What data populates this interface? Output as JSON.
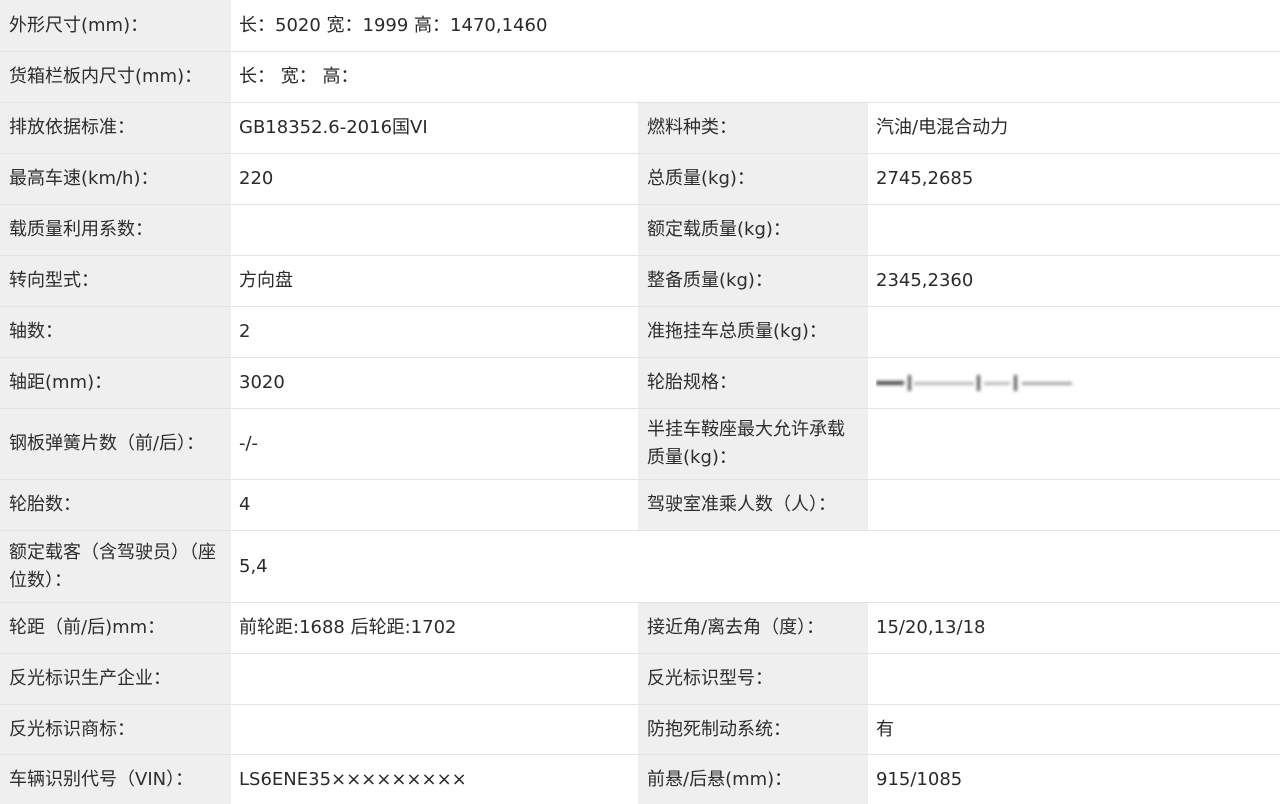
{
  "rows": [
    {
      "label": "外形尺寸(mm)：",
      "value": "长：5020 宽：1999 高：1470,1460"
    },
    {
      "label": "货箱栏板内尺寸(mm)：",
      "value": "长： 宽： 高："
    },
    {
      "label": "排放依据标准：",
      "value": "GB18352.6-2016国VI",
      "label2": "燃料种类：",
      "value2": "汽油/电混合动力"
    },
    {
      "label": "最高车速(km/h)：",
      "value": "220",
      "label2": "总质量(kg)：",
      "value2": "2745,2685"
    },
    {
      "label": "载质量利用系数：",
      "value": "",
      "label2": "额定载质量(kg)：",
      "value2": ""
    },
    {
      "label": "转向型式：",
      "value": "方向盘",
      "label2": "整备质量(kg)：",
      "value2": "2345,2360"
    },
    {
      "label": "轴数：",
      "value": "2",
      "label2": "准拖挂车总质量(kg)：",
      "value2": ""
    },
    {
      "label": "轴距(mm)：",
      "value": "3020",
      "label2": "轮胎规格：",
      "value2": ""
    },
    {
      "label": "钢板弹簧片数（前/后）：",
      "value": "-/-",
      "label2": "半挂车鞍座最大允许承载质量(kg)：",
      "value2": ""
    },
    {
      "label": "轮胎数：",
      "value": "4",
      "label2": "驾驶室准乘人数（人）：",
      "value2": ""
    },
    {
      "label": "额定载客（含驾驶员）（座位数）：",
      "value": "5,4"
    },
    {
      "label": "轮距（前/后)mm：",
      "value": "前轮距:1688 后轮距:1702",
      "label2": "接近角/离去角（度）：",
      "value2": "15/20,13/18"
    },
    {
      "label": "反光标识生产企业：",
      "value": "",
      "label2": "反光标识型号：",
      "value2": ""
    },
    {
      "label": "反光标识商标：",
      "value": "",
      "label2": "防抱死制动系统：",
      "value2": "有"
    },
    {
      "label": "车辆识别代号（VIN）：",
      "value": "LS6ENE35×××××××××",
      "label2": "前悬/后悬(mm)：",
      "value2": "915/1085"
    }
  ],
  "icons": {
    "tire_spec_value": "blurred-redaction-icon"
  },
  "colors": {
    "label_bg": "#efefef",
    "value_bg": "#ffffff",
    "border": "#e3e3e3"
  }
}
